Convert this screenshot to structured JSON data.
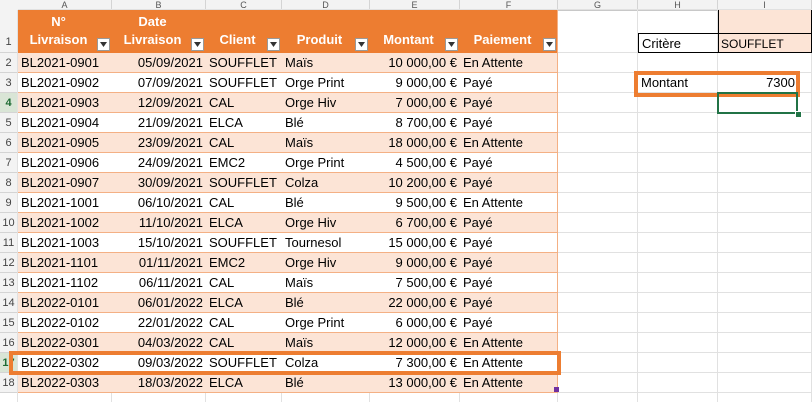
{
  "columns": [
    "A",
    "B",
    "C",
    "D",
    "E",
    "F",
    "G",
    "H",
    "I"
  ],
  "row_numbers": [
    "1",
    "2",
    "3",
    "4",
    "5",
    "6",
    "7",
    "8",
    "9",
    "10",
    "11",
    "12",
    "13",
    "14",
    "15",
    "16",
    "17",
    "18"
  ],
  "table": {
    "headers": [
      {
        "line1": "N°",
        "line2": "Livraison"
      },
      {
        "line1": "Date",
        "line2": "Livraison"
      },
      {
        "line1": "",
        "line2": "Client"
      },
      {
        "line1": "",
        "line2": "Produit"
      },
      {
        "line1": "",
        "line2": "Montant"
      },
      {
        "line1": "",
        "line2": "Paiement"
      }
    ],
    "rows": [
      [
        "BL2021-0901",
        "05/09/2021",
        "SOUFFLET",
        "Maïs",
        "10 000,00 €",
        "En Attente"
      ],
      [
        "BL2021-0902",
        "07/09/2021",
        "SOUFFLET",
        "Orge Print",
        "9 000,00 €",
        "Payé"
      ],
      [
        "BL2021-0903",
        "12/09/2021",
        "CAL",
        "Orge Hiv",
        "7 000,00 €",
        "Payé"
      ],
      [
        "BL2021-0904",
        "21/09/2021",
        "ELCA",
        "Blé",
        "8 700,00 €",
        "Payé"
      ],
      [
        "BL2021-0905",
        "23/09/2021",
        "CAL",
        "Maïs",
        "18 000,00 €",
        "En Attente"
      ],
      [
        "BL2021-0906",
        "24/09/2021",
        "EMC2",
        "Orge Print",
        "4 500,00 €",
        "Payé"
      ],
      [
        "BL2021-0907",
        "30/09/2021",
        "SOUFFLET",
        "Colza",
        "10 200,00 €",
        "Payé"
      ],
      [
        "BL2021-1001",
        "06/10/2021",
        "CAL",
        "Blé",
        "9 500,00 €",
        "En Attente"
      ],
      [
        "BL2021-1002",
        "11/10/2021",
        "ELCA",
        "Orge Hiv",
        "6 700,00 €",
        "Payé"
      ],
      [
        "BL2021-1003",
        "15/10/2021",
        "SOUFFLET",
        "Tournesol",
        "15 000,00 €",
        "Payé"
      ],
      [
        "BL2021-1101",
        "01/11/2021",
        "EMC2",
        "Orge Hiv",
        "9 000,00 €",
        "Payé"
      ],
      [
        "BL2021-1102",
        "06/11/2021",
        "CAL",
        "Maïs",
        "7 500,00 €",
        "Payé"
      ],
      [
        "BL2022-0101",
        "06/01/2022",
        "ELCA",
        "Blé",
        "22 000,00 €",
        "Payé"
      ],
      [
        "BL2022-0102",
        "22/01/2022",
        "CAL",
        "Orge Print",
        "6 000,00 €",
        "Payé"
      ],
      [
        "BL2022-0301",
        "04/03/2022",
        "CAL",
        "Maïs",
        "12 000,00 €",
        "En Attente"
      ],
      [
        "BL2022-0302",
        "09/03/2022",
        "SOUFFLET",
        "Colza",
        "7 300,00 €",
        "En Attente"
      ],
      [
        "BL2022-0303",
        "18/03/2022",
        "ELCA",
        "Blé",
        "13 000,00 €",
        "En Attente"
      ]
    ]
  },
  "criteria": {
    "label": "Critère",
    "value": "SOUFFLET",
    "result_label": "Montant",
    "result_value": "7300"
  },
  "colors": {
    "header": "#ed7d31",
    "band": "#fce4d6",
    "highlight_border": "#ed7d31",
    "selection": "#217346"
  }
}
